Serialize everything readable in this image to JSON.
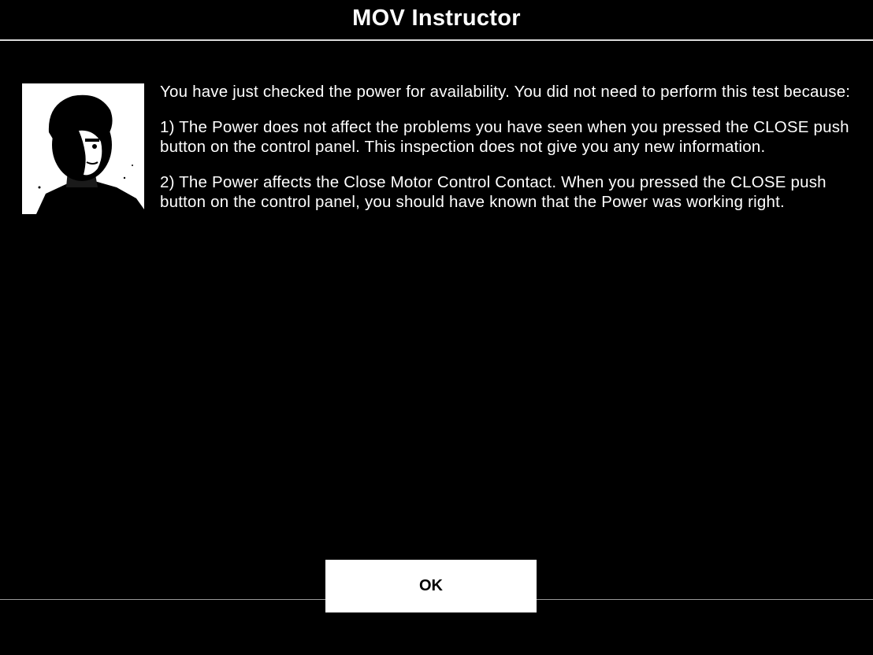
{
  "window": {
    "title": "MOV Instructor"
  },
  "instructor": {
    "portrait_icon": "instructor-portrait"
  },
  "message": {
    "intro": "You have just checked the power for availability.  You did not need to perform this test because:",
    "reason_1": "1)  The Power does not affect the problems you have seen when you pressed the CLOSE push button on the control panel.  This inspection does not give you any new information.",
    "reason_2": "2)  The Power affects the Close Motor Control Contact.  When you pressed the CLOSE push button on the control panel, you should have known that the Power was working right."
  },
  "buttons": {
    "ok_label": "OK"
  },
  "colors": {
    "background": "#000000",
    "text": "#ffffff",
    "button_background": "#ffffff",
    "button_text": "#000000"
  }
}
